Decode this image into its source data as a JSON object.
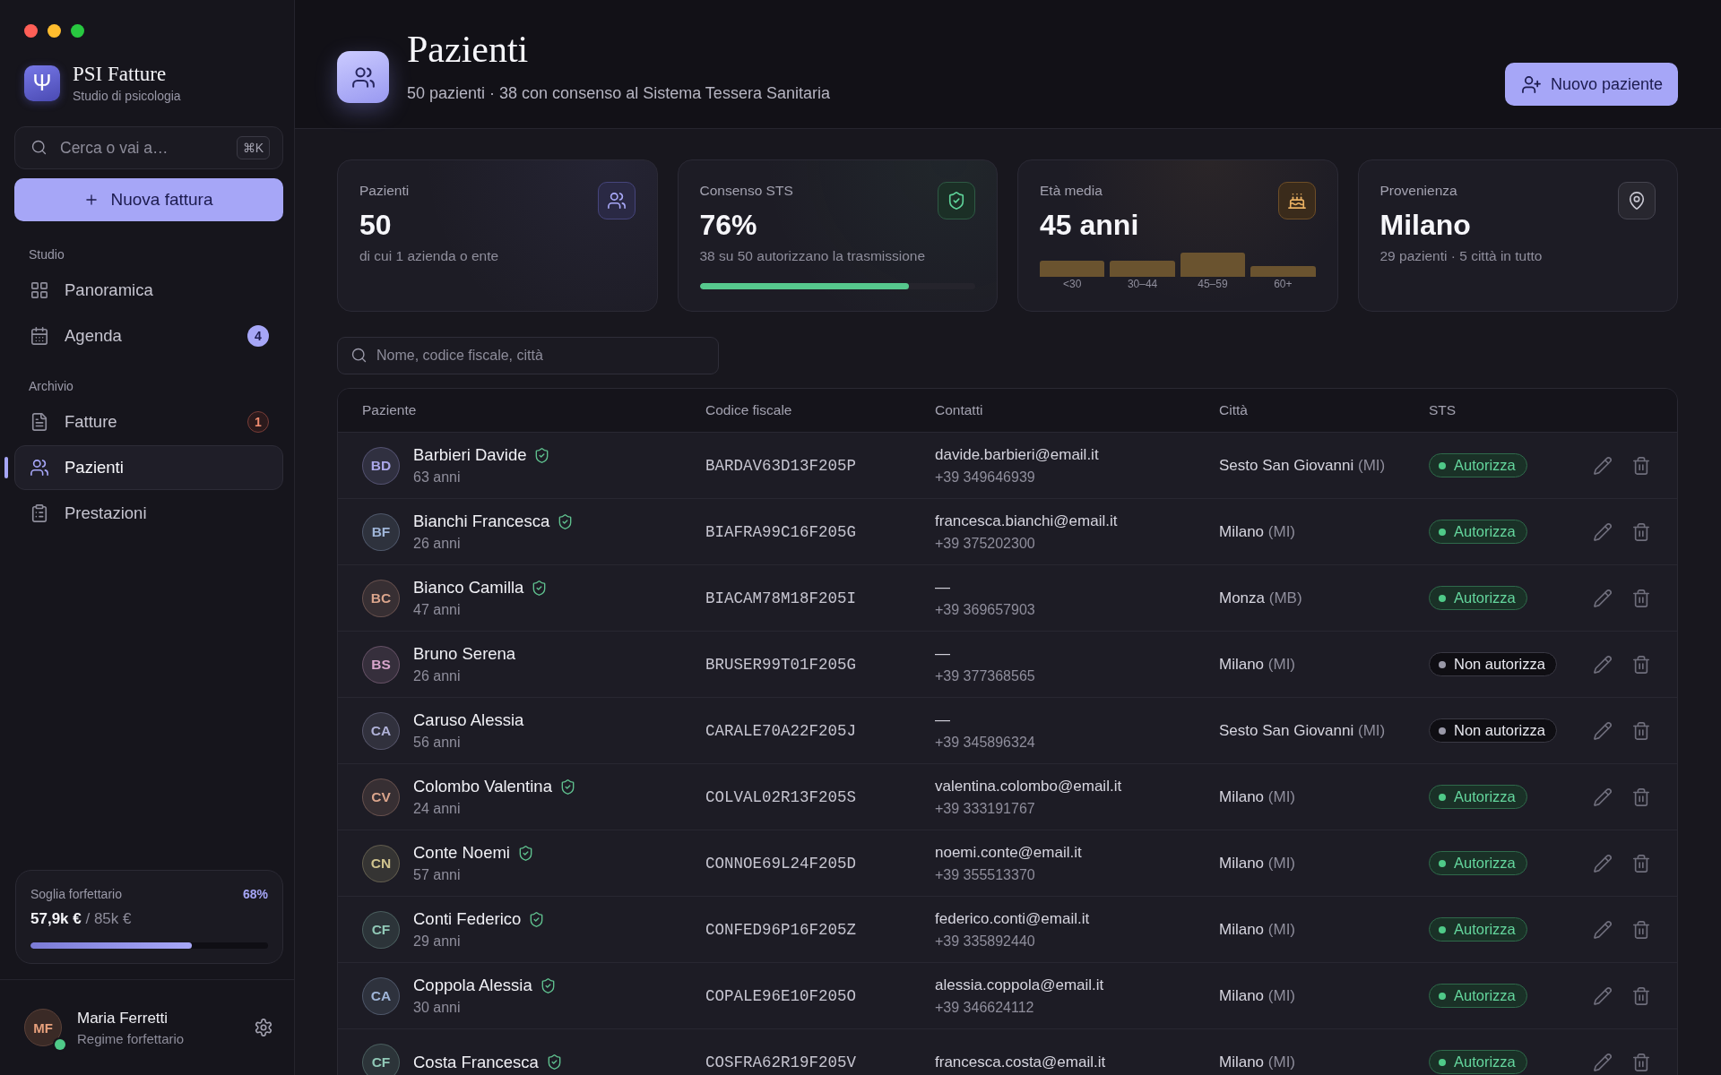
{
  "app": {
    "logo": "Ψ",
    "name": "PSI Fatture",
    "subtitle": "Studio di psicologia"
  },
  "sidebar": {
    "search": {
      "placeholder": "Cerca o vai a…",
      "shortcut": "⌘K"
    },
    "new_button": {
      "label": "Nuova fattura"
    },
    "sections": [
      {
        "title": "Studio",
        "items": [
          {
            "kind": "grid",
            "label": "Panoramica",
            "selected": false
          },
          {
            "kind": "calendar",
            "label": "Agenda",
            "selected": false,
            "badge": {
              "kind": "info",
              "text": "4"
            }
          }
        ]
      },
      {
        "title": "Archivio",
        "items": [
          {
            "kind": "document",
            "label": "Fatture",
            "selected": false,
            "badge": {
              "kind": "warning",
              "text": "1"
            }
          },
          {
            "kind": "people",
            "label": "Pazienti",
            "selected": true
          },
          {
            "kind": "clipboard",
            "label": "Prestazioni",
            "selected": false
          }
        ]
      }
    ],
    "threshold": {
      "label": "Soglia forfettario",
      "percent": "68%",
      "amount": "57,9k €",
      "limit": "/ 85k €",
      "level": 0.68
    },
    "user": {
      "initials": "MF",
      "name": "Maria Ferretti",
      "role": "Regime forfettario",
      "online": true
    }
  },
  "header": {
    "title": "Pazienti",
    "subtitle": "50 pazienti · 38 con consenso al Sistema Tessera Sanitaria",
    "button": {
      "label": "Nuovo paziente"
    }
  },
  "stats": [
    {
      "kind": "patients",
      "label": "Pazienti",
      "value": "50",
      "note": "di cui 1 azienda o ente"
    },
    {
      "kind": "consent",
      "label": "Consenso STS",
      "value": "76%",
      "note": "38 su 50 autorizzano la trasmissione",
      "level": 0.76
    },
    {
      "kind": "age",
      "label": "Età media",
      "value": "45 anni",
      "bars": [
        {
          "label": "<30"
        },
        {
          "label": "30–44"
        },
        {
          "label": "45–59"
        },
        {
          "label": "60+"
        }
      ]
    },
    {
      "kind": "origin",
      "label": "Provenienza",
      "value": "Milano",
      "note": "29 pazienti · 5 città in tutto"
    }
  ],
  "filter": {
    "placeholder": "Nome, codice fiscale, città"
  },
  "table": {
    "columns": [
      "Paziente",
      "Codice fiscale",
      "Contatti",
      "Città",
      "STS"
    ],
    "rows": [
      {
        "initials": "BD",
        "color": "#aaa7e8",
        "name": "Barbieri Davide",
        "age": "63 anni",
        "fiscal_code": "BARDAV63D13F205P",
        "email": "davide.barbieri@email.it",
        "phone": "+39 349646939",
        "city": "Sesto San Giovanni",
        "province": "(MI)",
        "sts": {
          "label": "Autorizza",
          "authorized": true
        }
      },
      {
        "initials": "BF",
        "color": "#9fb5d8",
        "name": "Bianchi Francesca",
        "age": "26 anni",
        "fiscal_code": "BIAFRA99C16F205G",
        "email": "francesca.bianchi@email.it",
        "phone": "+39 375202300",
        "city": "Milano",
        "province": "(MI)",
        "sts": {
          "label": "Autorizza",
          "authorized": true
        }
      },
      {
        "initials": "BC",
        "color": "#dba58c",
        "name": "Bianco Camilla",
        "age": "47 anni",
        "fiscal_code": "BIACAM78M18F205I",
        "email": "—",
        "phone": "+39 369657903",
        "city": "Monza",
        "province": "(MB)",
        "sts": {
          "label": "Autorizza",
          "authorized": true
        }
      },
      {
        "initials": "BS",
        "color": "#d8a5cb",
        "name": "Bruno Serena",
        "age": "26 anni",
        "fiscal_code": "BRUSER99T01F205G",
        "email": "—",
        "phone": "+39 377368565",
        "city": "Milano",
        "province": "(MI)",
        "sts": {
          "label": "Non autorizza",
          "authorized": false
        }
      },
      {
        "initials": "CA",
        "color": "#b0b2d8",
        "name": "Caruso Alessia",
        "age": "56 anni",
        "fiscal_code": "CARALE70A22F205J",
        "email": "—",
        "phone": "+39 345896324",
        "city": "Sesto San Giovanni",
        "province": "(MI)",
        "sts": {
          "label": "Non autorizza",
          "authorized": false
        }
      },
      {
        "initials": "CV",
        "color": "#dba58c",
        "name": "Colombo Valentina",
        "age": "24 anni",
        "fiscal_code": "COLVAL02R13F205S",
        "email": "valentina.colombo@email.it",
        "phone": "+39 333191767",
        "city": "Milano",
        "province": "(MI)",
        "sts": {
          "label": "Autorizza",
          "authorized": true
        }
      },
      {
        "initials": "CN",
        "color": "#d0c48f",
        "name": "Conte Noemi",
        "age": "57 anni",
        "fiscal_code": "CONNOE69L24F205D",
        "email": "noemi.conte@email.it",
        "phone": "+39 355513370",
        "city": "Milano",
        "province": "(MI)",
        "sts": {
          "label": "Autorizza",
          "authorized": true
        }
      },
      {
        "initials": "CF",
        "color": "#90c8b6",
        "name": "Conti Federico",
        "age": "29 anni",
        "fiscal_code": "CONFED96P16F205Z",
        "email": "federico.conti@email.it",
        "phone": "+39 335892440",
        "city": "Milano",
        "province": "(MI)",
        "sts": {
          "label": "Autorizza",
          "authorized": true
        }
      },
      {
        "initials": "CA",
        "color": "#9fb5d8",
        "name": "Coppola Alessia",
        "age": "30 anni",
        "fiscal_code": "COPALE96E10F205O",
        "email": "alessia.coppola@email.it",
        "phone": "+39 346624112",
        "city": "Milano",
        "province": "(MI)",
        "sts": {
          "label": "Autorizza",
          "authorized": true
        }
      },
      {
        "initials": "CF",
        "color": "#90c8b6",
        "name": "Costa Francesca",
        "fiscal_code": "COSFRA62R19F205V",
        "email": "francesca.costa@email.it",
        "city": "Milano",
        "province": "(MI)",
        "sts": {
          "label": "Autorizza",
          "authorized": true
        }
      }
    ]
  }
}
